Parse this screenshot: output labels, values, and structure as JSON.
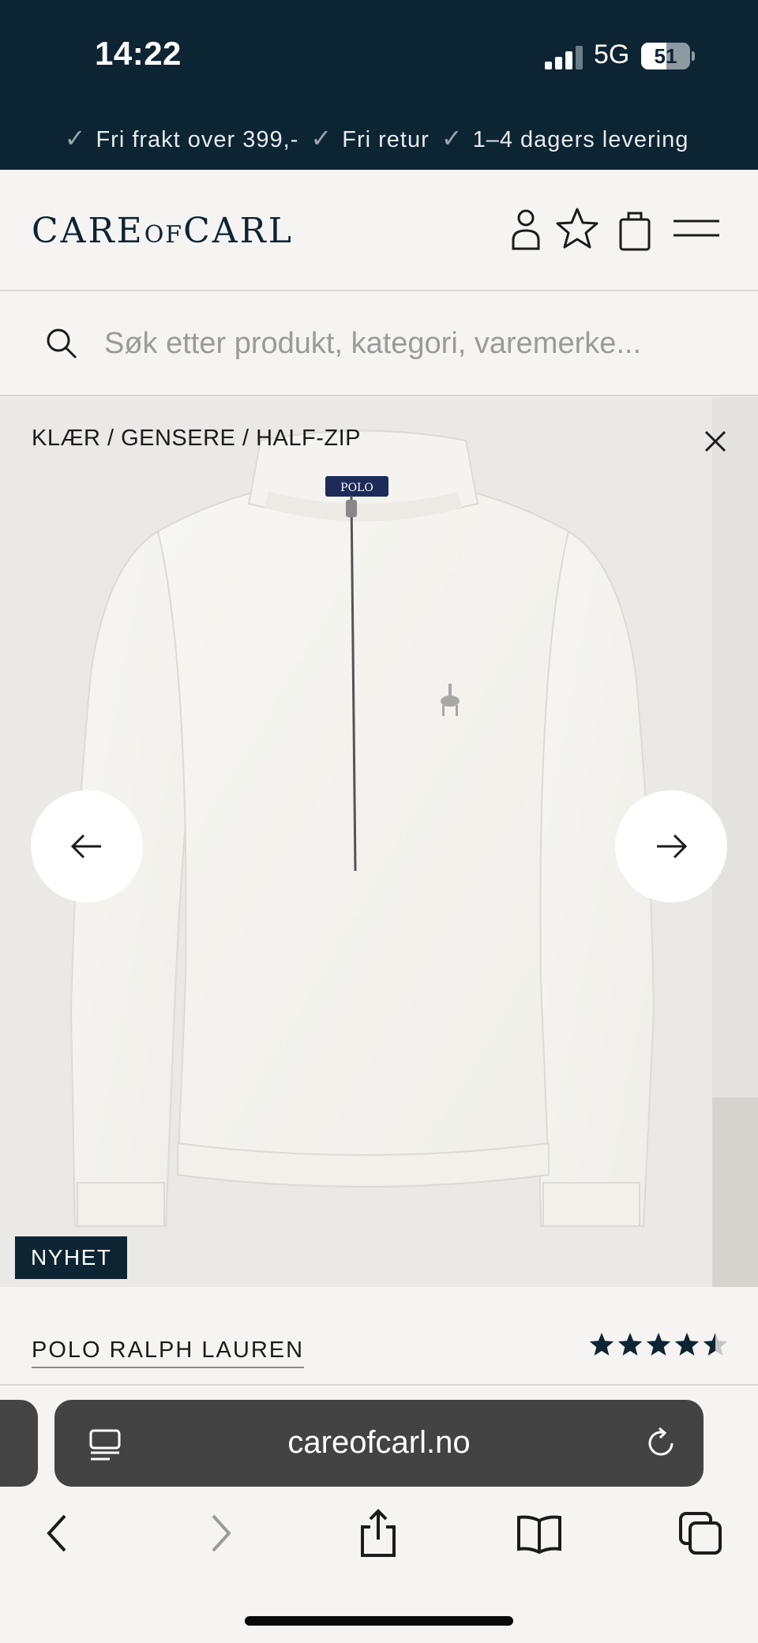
{
  "status_bar": {
    "time": "14:22",
    "network": "5G",
    "battery": "51",
    "battery_level": 0.51
  },
  "promo": {
    "items": [
      "Fri frakt over 399,-",
      "Fri retur",
      "1–4 dagers levering"
    ]
  },
  "header": {
    "logo_left": "CARE",
    "logo_mid": "OF",
    "logo_right": "CARL"
  },
  "search": {
    "placeholder": "Søk etter produkt, kategori, varemerke..."
  },
  "product": {
    "breadcrumb": "KLÆR / GENSERE / HALF-ZIP",
    "badge": "NYHET",
    "brand": "POLO RALPH LAUREN",
    "rating": 4.5,
    "collar_label": "POLO"
  },
  "browser": {
    "url": "careofcarl.no"
  },
  "colors": {
    "navy": "#0d2433",
    "background": "#f5f4f2"
  }
}
